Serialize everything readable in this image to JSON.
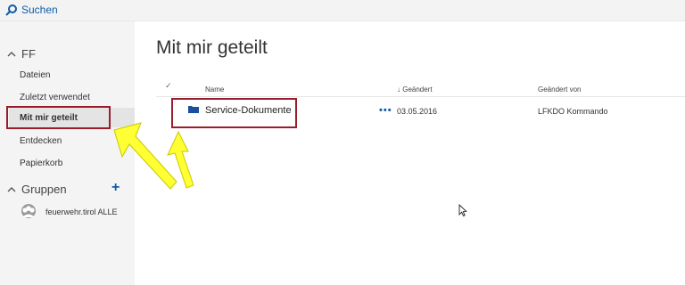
{
  "top": {
    "search_label": "Suchen"
  },
  "sidebar": {
    "section_label": "FF",
    "items": [
      {
        "label": "Dateien"
      },
      {
        "label": "Zuletzt verwendet"
      },
      {
        "label": "Mit mir geteilt",
        "active": true
      },
      {
        "label": "Entdecken"
      },
      {
        "label": "Papierkorb"
      }
    ],
    "groups_label": "Gruppen",
    "add_symbol": "+",
    "groups": [
      {
        "label": "feuerwehr.tirol ALLE"
      }
    ]
  },
  "main": {
    "title": "Mit mir geteilt",
    "columns": {
      "check": "✓",
      "name": "Name",
      "modified": "↓ Geändert",
      "modified_by": "Geändert von"
    },
    "rows": [
      {
        "name": "Service-Dokumente",
        "more": "•••",
        "modified": "03.05.2016",
        "modified_by": "LFKDO Kommando"
      }
    ]
  },
  "colors": {
    "accent": "#0f5ca8",
    "highlight_box": "#9b1c2b",
    "arrow_fill": "#ffff33",
    "sidebar_bg": "#f4f4f4"
  }
}
